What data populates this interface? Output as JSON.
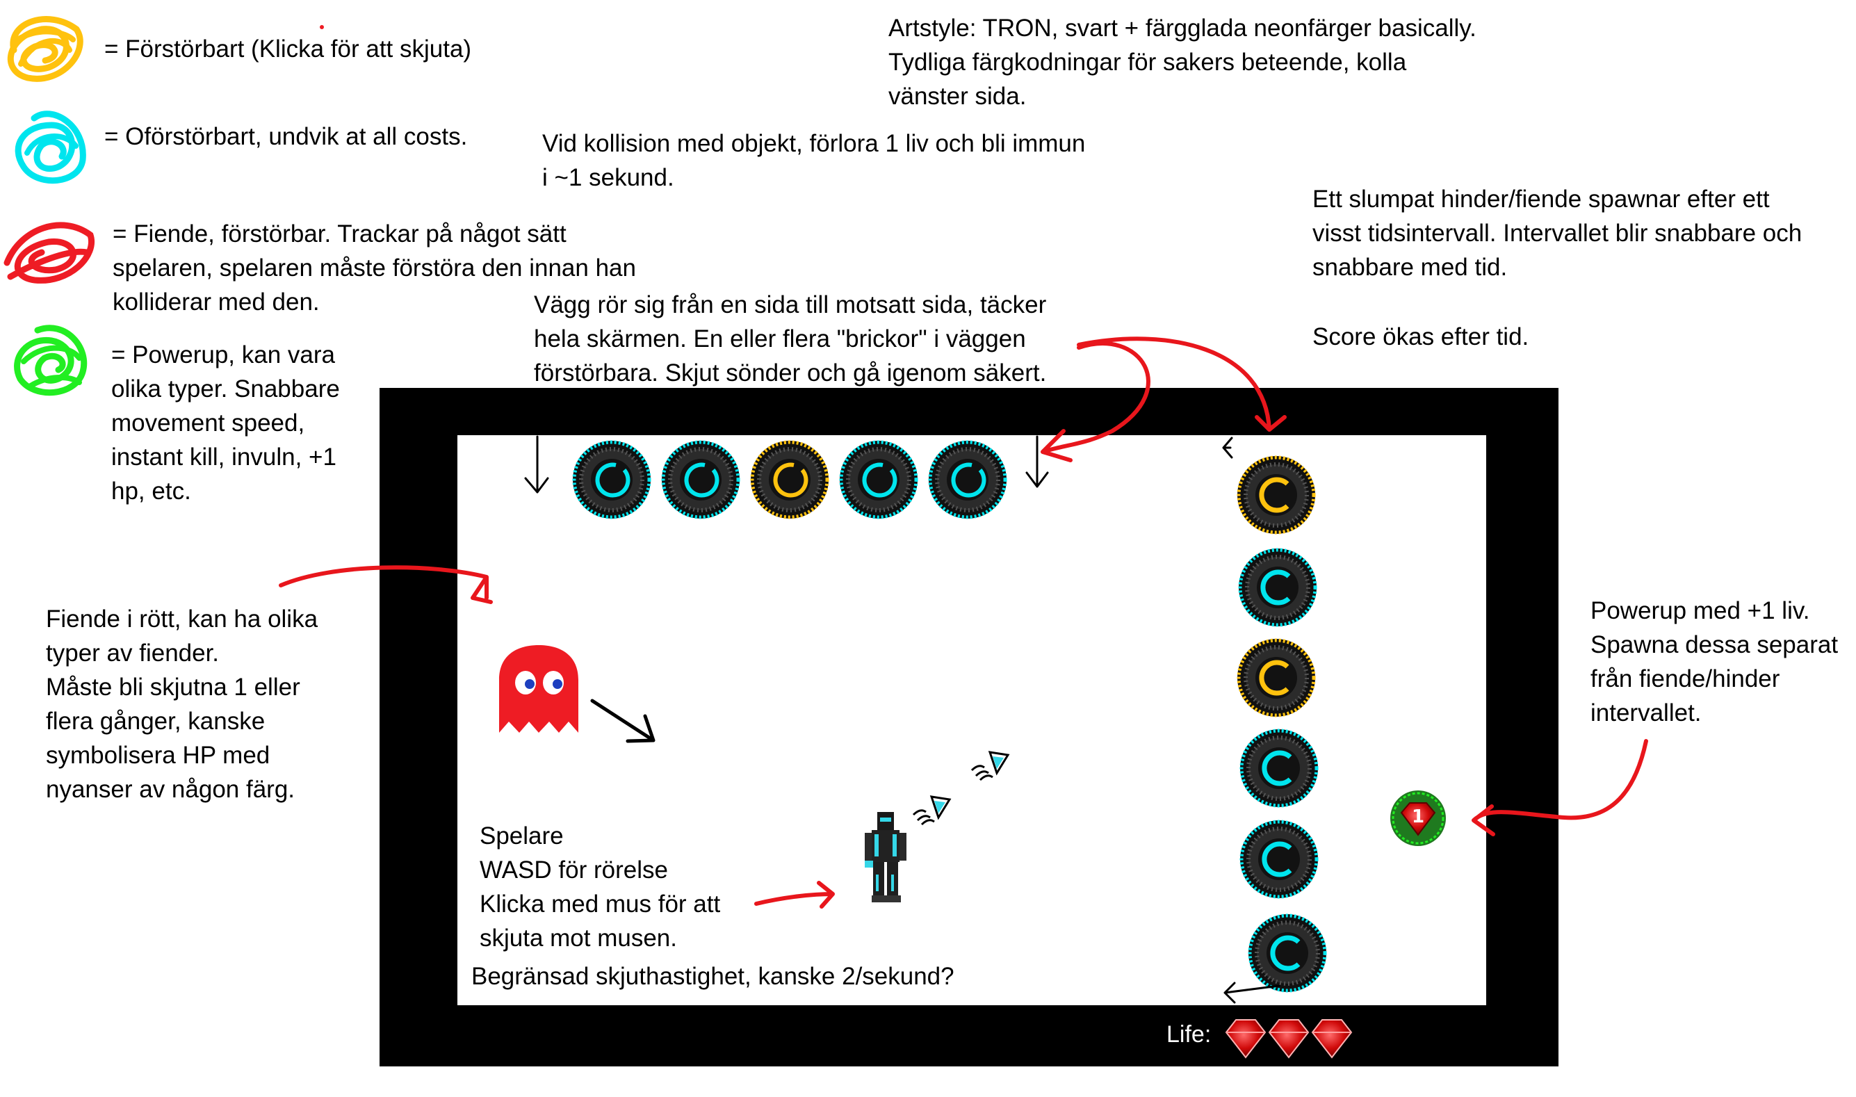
{
  "legend": [
    {
      "color": "#FFC20E",
      "label": "= Förstörbart (Klicka för att skjuta)"
    },
    {
      "color": "#00E5EE",
      "label": "= Oförstörbart, undvik at all costs."
    },
    {
      "color": "#EE1C24",
      "label": "= Fiende, förstörbar. Trackar på något sätt\nspelaren, spelaren måste förstöra den innan han\nkolliderar med den."
    },
    {
      "color": "#22EE22",
      "label": "= Powerup, kan vara\nolika typer. Snabbare\nmovement speed,\ninstant kill, invuln, +1\nhp, etc."
    }
  ],
  "notes": {
    "artstyle": "Artstyle: TRON, svart + färgglada neonfärger basically.\n Tydliga färgkodningar för sakers beteende, kolla\n vänster sida.",
    "collision": "Vid kollision med objekt, förlora 1 liv och bli immun\ni ~1 sekund.",
    "spawn": "Ett slumpat hinder/fiende spawnar efter ett\nvisst tidsintervall. Intervallet blir snabbare och\nsnabbare med tid.",
    "score": "Score ökas efter tid.",
    "wall": "Vägg rör sig från en sida till motsatt sida, täcker\nhela skärmen. En eller flera \"brickor\" i väggen\nförstörbara. Skjut sönder och gå igenom säkert.",
    "enemy": "Fiende i rött, kan ha olika\ntyper av fiender.\nMåste bli skjutna 1 eller\nflera gånger, kanske\nsymbolisera HP med\nnyanser av någon färg.",
    "powerup": "Powerup med +1 liv.\nSpawna dessa separat\nfrån fiende/hinder\nintervallet.",
    "player": "Spelare\nWASD för rörelse\nKlicka med mus för att\n skjuta mot musen.",
    "rate": "Begränsad skjuthastighet, kanske 2/sekund?"
  },
  "game": {
    "life_label": "Life:",
    "lives": 3,
    "powerup_value": "1",
    "top_wall": [
      "cyan",
      "cyan",
      "yellow",
      "cyan",
      "cyan"
    ],
    "side_wall": [
      "yellow",
      "cyan",
      "yellow",
      "cyan",
      "cyan",
      "cyan"
    ]
  },
  "colors": {
    "destructible": "#FFC20E",
    "indestructible": "#00E5EE",
    "enemy": "#EE1C24",
    "powerup": "#22EE22",
    "annotation_arrow": "#E8161C"
  }
}
